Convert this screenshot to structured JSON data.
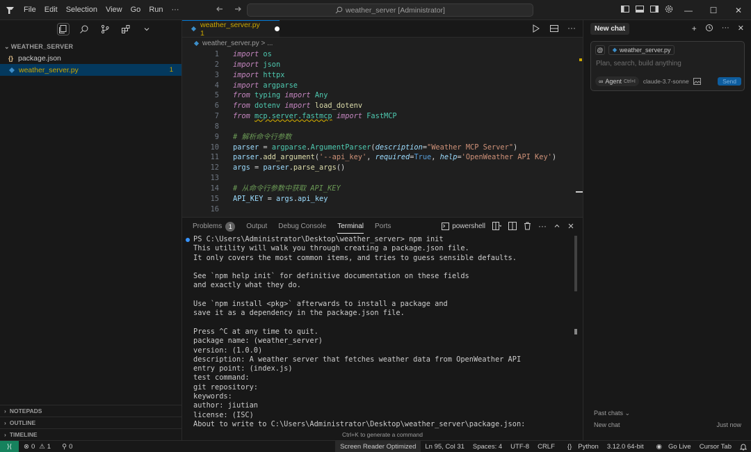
{
  "window": {
    "search_text": "weather_server [Administrator]",
    "menu": [
      "File",
      "Edit",
      "Selection",
      "View",
      "Go",
      "Run",
      "···"
    ]
  },
  "sidebar": {
    "section_title": "WEATHER_SERVER",
    "files": [
      {
        "name": "package.json",
        "icon": "{}"
      },
      {
        "name": "weather_server.py",
        "badge": "1"
      }
    ],
    "panels": [
      "NOTEPADS",
      "OUTLINE",
      "TIMELINE"
    ]
  },
  "editor": {
    "tab_label": "weather_server.py 1",
    "breadcrumb": "weather_server.py > ...",
    "line_numbers": [
      "1",
      "2",
      "3",
      "4",
      "5",
      "6",
      "7",
      "8",
      "9",
      "10",
      "11",
      "12",
      "13",
      "14",
      "15",
      "16"
    ]
  },
  "panel": {
    "tabs": [
      "Problems",
      "Output",
      "Debug Console",
      "Terminal",
      "Ports"
    ],
    "problems_count": "1",
    "shell_label": "powershell",
    "terminal_lines": [
      "PS C:\\Users\\Administrator\\Desktop\\weather_server> npm init",
      "This utility will walk you through creating a package.json file.",
      "It only covers the most common items, and tries to guess sensible defaults.",
      "",
      "See `npm help init` for definitive documentation on these fields",
      "and exactly what they do.",
      "",
      "Use `npm install <pkg>` afterwards to install a package and",
      "save it as a dependency in the package.json file.",
      "",
      "Press ^C at any time to quit.",
      "package name: (weather_server)",
      "version: (1.0.0)",
      "description: A weather server that fetches weather data from OpenWeather API",
      "entry point: (index.js)",
      "test command:",
      "git repository:",
      "keywords:",
      "author: jiutian",
      "license: (ISC)",
      "About to write to C:\\Users\\Administrator\\Desktop\\weather_server\\package.json:"
    ],
    "hint": "Ctrl+K to generate a command"
  },
  "chat": {
    "title": "New chat",
    "context_file": "weather_server.py",
    "placeholder": "Plan, search, build anything",
    "agent_label": "Agent",
    "agent_shortcut": "Ctrl+I",
    "model": "claude-3.7-sonnet",
    "send_label": "Send",
    "past_chats_label": "Past chats",
    "past_chat_title": "New chat",
    "past_chat_time": "Just now"
  },
  "statusbar": {
    "errors": "0",
    "warnings": "1",
    "ports": "0",
    "screen_reader": "Screen Reader Optimized",
    "position": "Ln 95, Col 31",
    "spaces": "Spaces: 4",
    "encoding": "UTF-8",
    "eol": "CRLF",
    "language": "Python",
    "interpreter": "3.12.0 64-bit",
    "go_live": "Go Live",
    "cursor_tab": "Cursor Tab"
  },
  "colors": {
    "accent": "#0078d4",
    "warning": "#cca700",
    "remote": "#16825d"
  }
}
